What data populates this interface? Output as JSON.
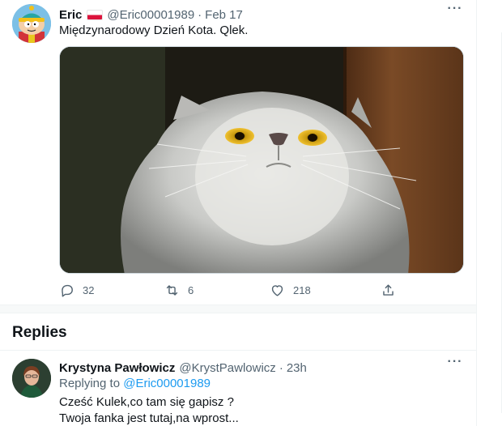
{
  "tweet": {
    "author_name": "Eric",
    "handle": "@Eric00001989",
    "separator": "·",
    "date": "Feb 17",
    "more": "···",
    "text": "Międzynarodowy Dzień Kota. Qlek.",
    "actions": {
      "reply_count": "32",
      "retweet_count": "6",
      "like_count": "218"
    }
  },
  "replies_heading": "Replies",
  "reply": {
    "author_name": "Krystyna Pawłowicz",
    "handle": "@KrystPawlowicz",
    "separator": "·",
    "time": "23h",
    "more": "···",
    "replying_prefix": "Replying to",
    "replying_to": "@Eric00001989",
    "text_line1": "Cześć Kulek,co tam się gapisz ?",
    "text_line2": "Twoja fanka jest tutaj,na wprost..."
  },
  "colors": {
    "accent": "#1d9bf0",
    "muted": "#536471",
    "text": "#0f1419",
    "flag_red": "#dc143c"
  },
  "icons": [
    "avatar-cartman",
    "poland-flag-icon",
    "more-icon",
    "reply-icon",
    "retweet-icon",
    "like-icon",
    "share-icon"
  ]
}
